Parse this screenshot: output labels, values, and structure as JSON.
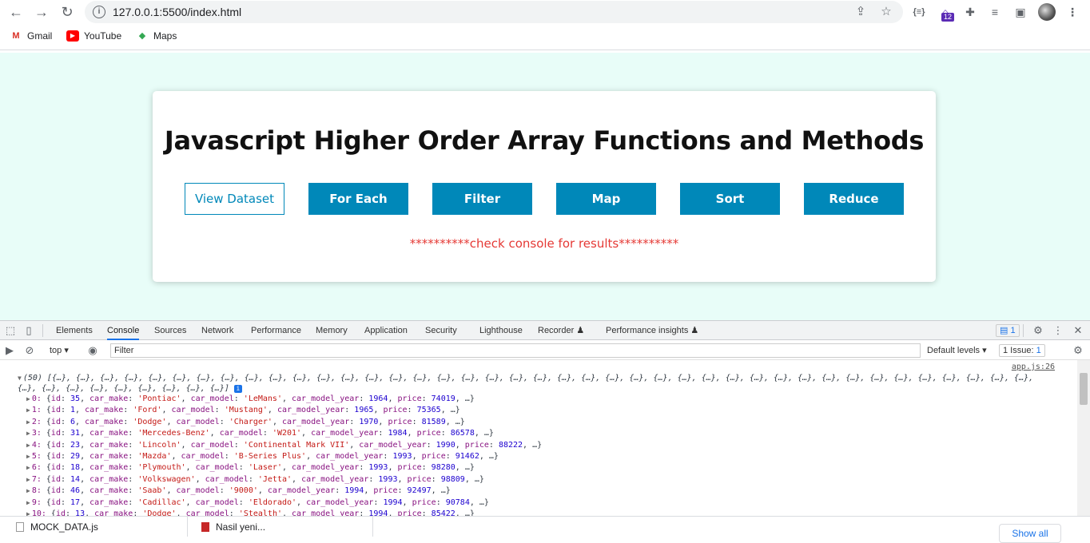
{
  "browser": {
    "url": "127.0.0.1:5500/index.html",
    "nav": {
      "back": "←",
      "forward": "→",
      "reload": "↻"
    },
    "ext_badge": "12",
    "bookmarks": [
      {
        "label": "Gmail",
        "icon": "gmail-icon"
      },
      {
        "label": "YouTube",
        "icon": "youtube-icon"
      },
      {
        "label": "Maps",
        "icon": "maps-icon"
      }
    ]
  },
  "page": {
    "title": "Javascript Higher Order Array Functions and Methods",
    "buttons": [
      {
        "label": "View Dataset",
        "style": "outline"
      },
      {
        "label": "For Each",
        "style": "primary"
      },
      {
        "label": "Filter",
        "style": "primary"
      },
      {
        "label": "Map",
        "style": "primary"
      },
      {
        "label": "Sort",
        "style": "primary"
      },
      {
        "label": "Reduce",
        "style": "primary"
      }
    ],
    "notice": "**********check console for results**********",
    "colors": {
      "background": "#e8fdf8",
      "accent": "#0088b9",
      "notice": "#e53935"
    }
  },
  "devtools": {
    "tabs": [
      "Elements",
      "Console",
      "Sources",
      "Network",
      "Performance",
      "Memory",
      "Application",
      "Security",
      "Lighthouse",
      "Recorder",
      "Performance insights"
    ],
    "active_tab": "Console",
    "messages_count": "1",
    "context": "top",
    "filter_placeholder": "Filter",
    "levels": "Default levels",
    "issues": "1 Issue:",
    "issues_count": "1",
    "source_link": "app.js:26",
    "summary": "(50) [{…}, {…}, {…}, {…}, {…}, {…}, {…}, {…}, {…}, {…}, {…}, {…}, {…}, {…}, {…}, {…}, {…}, {…}, {…}, {…}, {…}, {…}, {…}, {…}, {…}, {…}, {…}, {…}, {…}, {…}, {…}, {…}, {…}, {…}, {…}, {…}, {…}, {…}, {…}, {…}, {…}, {…}, {…}, {…}, {…}, {…}, {…}, {…}, {…}, {…}]",
    "rows": [
      {
        "idx": "0",
        "id": "35",
        "make": "'Pontiac'",
        "model": "'LeMans'",
        "year": "1964",
        "price": "74019"
      },
      {
        "idx": "1",
        "id": "1",
        "make": "'Ford'",
        "model": "'Mustang'",
        "year": "1965",
        "price": "75365"
      },
      {
        "idx": "2",
        "id": "6",
        "make": "'Dodge'",
        "model": "'Charger'",
        "year": "1970",
        "price": "81589"
      },
      {
        "idx": "3",
        "id": "31",
        "make": "'Mercedes-Benz'",
        "model": "'W201'",
        "year": "1984",
        "price": "86578"
      },
      {
        "idx": "4",
        "id": "23",
        "make": "'Lincoln'",
        "model": "'Continental Mark VII'",
        "year": "1990",
        "price": "88222"
      },
      {
        "idx": "5",
        "id": "29",
        "make": "'Mazda'",
        "model": "'B-Series Plus'",
        "year": "1993",
        "price": "91462"
      },
      {
        "idx": "6",
        "id": "18",
        "make": "'Plymouth'",
        "model": "'Laser'",
        "year": "1993",
        "price": "98280"
      },
      {
        "idx": "7",
        "id": "14",
        "make": "'Volkswagen'",
        "model": "'Jetta'",
        "year": "1993",
        "price": "98809"
      },
      {
        "idx": "8",
        "id": "46",
        "make": "'Saab'",
        "model": "'9000'",
        "year": "1994",
        "price": "92497"
      },
      {
        "idx": "9",
        "id": "17",
        "make": "'Cadillac'",
        "model": "'Eldorado'",
        "year": "1994",
        "price": "90784"
      },
      {
        "idx": "10",
        "id": "13",
        "make": "'Dodge'",
        "model": "'Stealth'",
        "year": "1994",
        "price": "85422"
      }
    ]
  },
  "downloads": {
    "items": [
      "MOCK_DATA.js",
      "Nasil yeni..."
    ],
    "show_all": "Show all"
  }
}
